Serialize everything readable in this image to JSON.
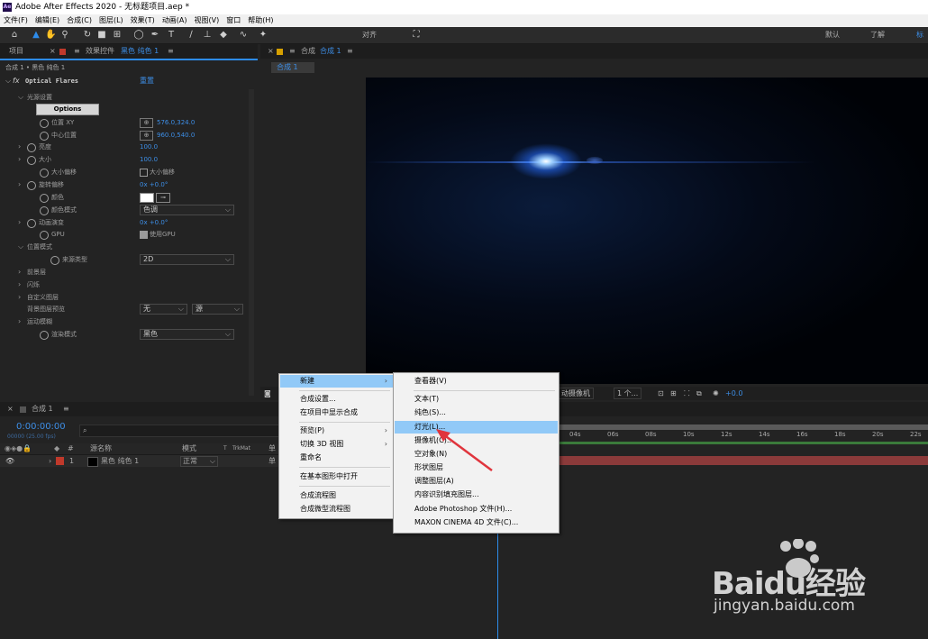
{
  "window": {
    "app_icon": "Ae",
    "title": "Adobe After Effects 2020 - 无标题项目.aep *"
  },
  "menubar": [
    "文件(F)",
    "编辑(E)",
    "合成(C)",
    "图层(L)",
    "效果(T)",
    "动画(A)",
    "视图(V)",
    "窗口",
    "帮助(H)"
  ],
  "toolbar": {
    "snap_label": "对齐",
    "workspace_default": "默认",
    "workspace_learn": "了解",
    "workspace_standard": "标"
  },
  "project_panel": {
    "tab_project": "项目",
    "tab_effects_prefix": "效果控件",
    "tab_effects_layer": "黑色 纯色 1",
    "breadcrumb": "合成 1 • 黑色 纯色 1"
  },
  "effect": {
    "fx": "fx",
    "name": "Optical Flares",
    "reset": "重置",
    "options_button": "Options",
    "rows": [
      {
        "indent": 1,
        "arrow": "⌵",
        "label": "光源设置"
      },
      {
        "indent": 2,
        "sw": true,
        "label": "位置 XY",
        "target": true,
        "value": "576.0,324.0"
      },
      {
        "indent": 2,
        "sw": true,
        "label": "中心位置",
        "target": true,
        "value": "960.0,540.0"
      },
      {
        "indent": 1,
        "arrow": "›",
        "sw": true,
        "label": "亮度",
        "value": "100.0"
      },
      {
        "indent": 1,
        "arrow": "›",
        "sw": true,
        "label": "大小",
        "value": "100.0"
      },
      {
        "indent": 2,
        "sw": true,
        "label": "大小偏移",
        "checkbox": true,
        "value": "大小偏移",
        "value_gray": true
      },
      {
        "indent": 1,
        "arrow": "›",
        "sw": true,
        "label": "旋转偏移",
        "value": "0x +0.0°"
      },
      {
        "indent": 2,
        "sw": true,
        "label": "颜色",
        "color_swatch": true
      },
      {
        "indent": 2,
        "sw": true,
        "label": "颜色模式",
        "dropdown": "色调"
      },
      {
        "indent": 1,
        "arrow": "›",
        "sw": true,
        "label": "动画演变",
        "value": "0x +0.0°"
      },
      {
        "indent": 2,
        "sw": true,
        "label": "GPU",
        "checkbox": true,
        "checked": true,
        "value": "使用GPU",
        "value_gray": true
      },
      {
        "indent": 1,
        "arrow": "⌵",
        "label": "位置模式"
      },
      {
        "indent": 3,
        "sw": true,
        "label": "来源类型",
        "dropdown": "2D"
      },
      {
        "indent": 1,
        "arrow": "›",
        "label": "前景层"
      },
      {
        "indent": 1,
        "arrow": "›",
        "label": "闪烁"
      },
      {
        "indent": 1,
        "arrow": "›",
        "label": "自定义图层"
      },
      {
        "indent": 1,
        "label": "背景图层预览",
        "dropdown": "无",
        "dropdown2": "源"
      },
      {
        "indent": 1,
        "arrow": "›",
        "label": "运动模糊"
      },
      {
        "indent": 2,
        "sw": true,
        "label": "渲染模式",
        "dropdown": "黑色"
      }
    ]
  },
  "comp_panel": {
    "tab_label": "合成",
    "tab_comp": "合成 1",
    "subtab": "合成 1",
    "camera_dropdown": "动摄像机",
    "view_dropdown": "1 个...",
    "exposure": "+0.0"
  },
  "timeline": {
    "tab": "合成 1",
    "timecode": "0:00:00:00",
    "fps": "00000 (25.00 fps)",
    "search_icon": "⌕",
    "col_source": "源名称",
    "col_mode": "模式",
    "col_t": "T",
    "col_trkmat": "TrkMat",
    "col_switch": "单",
    "layer": {
      "num": "1",
      "name": "黑色 纯色 1",
      "mode": "正常",
      "switch": "单"
    },
    "ticks": [
      "04s",
      "06s",
      "08s",
      "10s",
      "12s",
      "14s",
      "16s",
      "18s",
      "20s",
      "22s"
    ]
  },
  "context_menu": {
    "items": [
      "新建",
      "合成设置...",
      "在项目中显示合成",
      "预览(P)",
      "切换 3D 视图",
      "重命名",
      "在基本图形中打开",
      "合成流程图",
      "合成微型流程图"
    ],
    "highlighted": "新建"
  },
  "submenu": {
    "items": [
      "查看器(V)",
      "文本(T)",
      "纯色(S)...",
      "灯光(L)...",
      "摄像机(C)...",
      "空对象(N)",
      "形状图层",
      "调整图层(A)",
      "内容识别填充图层...",
      "Adobe Photoshop 文件(H)...",
      "MAXON CINEMA 4D 文件(C)..."
    ],
    "highlighted": "灯光(L)..."
  },
  "watermark": {
    "brand": "Baidu经验",
    "url": "jingyan.baidu.com"
  },
  "colors": {
    "accent": "#2d8ceb",
    "menu_highlight": "#91c9f7",
    "layer_bar": "#8b3a3a",
    "arrow": "#e0353d",
    "label_red": "#c0392b"
  }
}
